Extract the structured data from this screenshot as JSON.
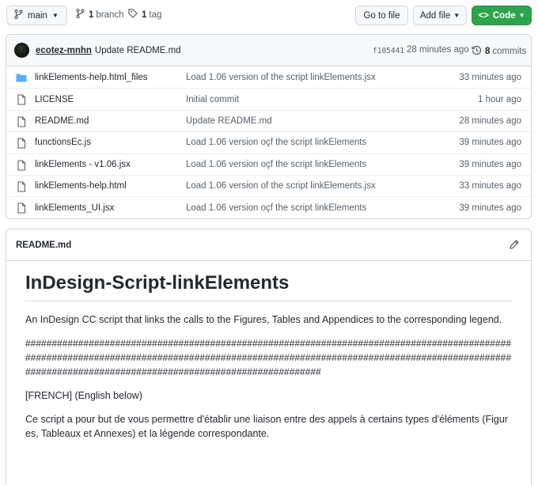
{
  "toolbar": {
    "branch_label": "main",
    "branch_count": "1",
    "branch_text": "branch",
    "tag_count": "1",
    "tag_text": "tag",
    "goto_label": "Go to file",
    "addfile_label": "Add file",
    "code_label": "Code"
  },
  "commit": {
    "author": "ecotez-mnhn",
    "message": "Update README.md",
    "sha": "f105441",
    "time": "28 minutes ago",
    "commit_count": "8",
    "commit_text": "commits"
  },
  "files": [
    {
      "name": "linkElements-help.html_files",
      "type": "folder",
      "message": "Load 1.06 version of the script linkElements.jsx",
      "time": "33 minutes ago"
    },
    {
      "name": "LICENSE",
      "type": "file",
      "message": "Initial commit",
      "time": "1 hour ago"
    },
    {
      "name": "README.md",
      "type": "file",
      "message": "Update README.md",
      "time": "28 minutes ago"
    },
    {
      "name": "functionsEc.js",
      "type": "file",
      "message": "Load 1.06 version oçf the script linkElements",
      "time": "39 minutes ago"
    },
    {
      "name": "linkElements - v1.06.jsx",
      "type": "file",
      "message": "Load 1.06 version oçf the script linkElements",
      "time": "39 minutes ago"
    },
    {
      "name": "linkElements-help.html",
      "type": "file",
      "message": "Load 1.06 version of the script linkElements.jsx",
      "time": "33 minutes ago"
    },
    {
      "name": "linkElements_UI.jsx",
      "type": "file",
      "message": "Load 1.06 version oçf the script linkElements",
      "time": "39 minutes ago"
    }
  ],
  "readme": {
    "filename": "README.md",
    "heading": "InDesign-Script-linkElements",
    "intro": "An InDesign CC script that links the calls to the Figures, Tables and Appendices to the corresponding legend.",
    "hashes": "################################################################################################################################################################################################################################################",
    "french_tag": "[FRENCH] (English below)",
    "french_text": "Ce script a pour but de vous permettre d'établir une liaison entre des appels à certains types d'éléments (Figures, Tableaux et Annexes) et la légende correspondante."
  },
  "colors": {
    "code_button": "#2da44e",
    "folder_icon": "#54aeff"
  }
}
